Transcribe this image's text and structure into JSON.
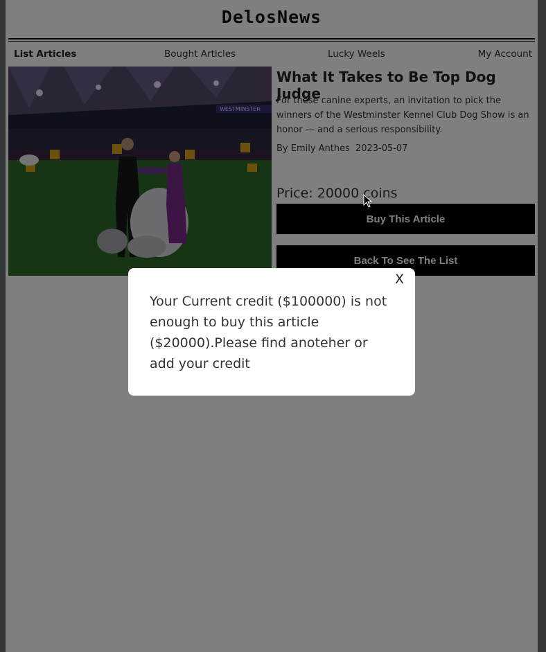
{
  "brand": {
    "logo": "DelosNews"
  },
  "nav": {
    "items": [
      {
        "label": "List Articles",
        "active": true
      },
      {
        "label": "Bought Articles",
        "active": false
      },
      {
        "label": "Lucky Weels",
        "active": false
      },
      {
        "label": "My Account",
        "active": false
      }
    ]
  },
  "article": {
    "image": {
      "banner_text": "WESTMINSTER"
    },
    "title": "What It Takes to Be Top Dog Judge",
    "description": "For these canine experts, an invitation to pick the winners of the Westminster Kennel Club Dog Show is an honor — and a serious responsibility.",
    "author": "By Emily Anthes",
    "date": "2023-05-07",
    "price": "Price: 20000 coins",
    "buy_label": "Buy This Article",
    "back_label": "Back To See The List"
  },
  "modal": {
    "close_label": "X",
    "message": "Your Current credit ($100000) is not enough to buy this article ($20000).Please find anoteher or add your credit"
  },
  "colors": {
    "overlay": "#000000",
    "button_bg": "#000000",
    "photo_carpet": "#2e5a2e",
    "judge_dress": "#7a2a8a"
  }
}
